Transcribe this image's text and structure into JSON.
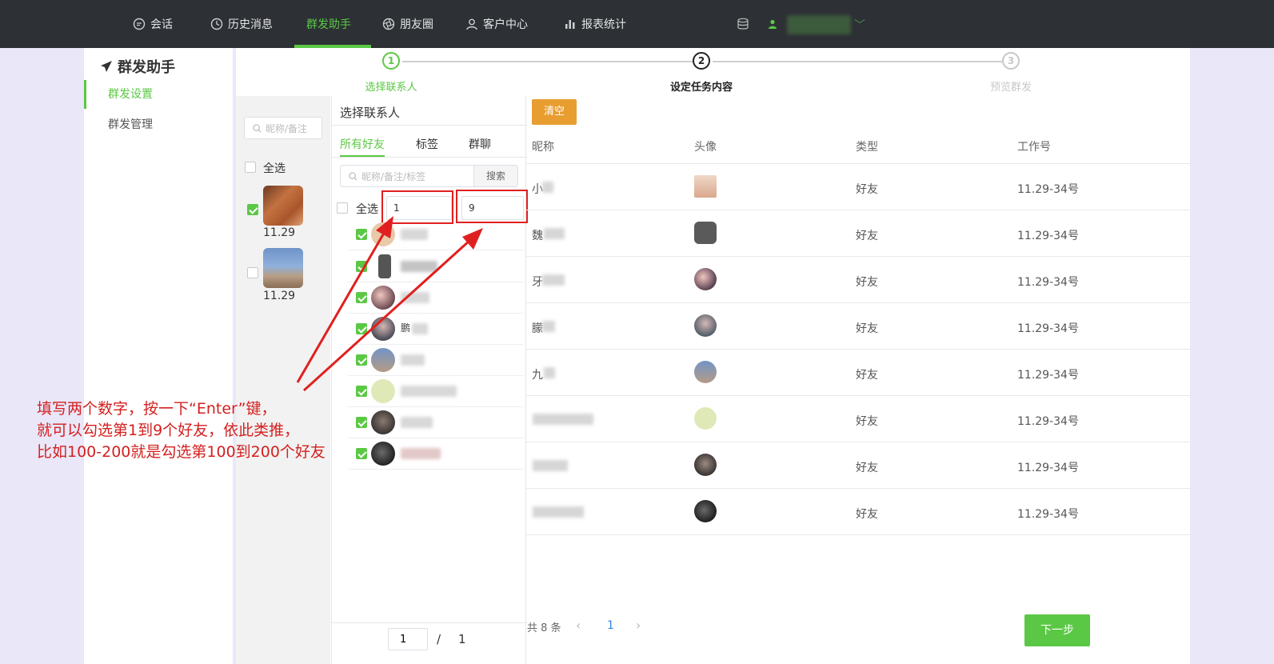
{
  "nav": {
    "items": [
      {
        "label": "会话",
        "icon": "chat-icon"
      },
      {
        "label": "历史消息",
        "icon": "clock-icon"
      },
      {
        "label": "群发助手",
        "icon": "",
        "active": true
      },
      {
        "label": "朋友圈",
        "icon": "aperture-icon"
      },
      {
        "label": "客户中心",
        "icon": "user-outline-icon"
      },
      {
        "label": "报表统计",
        "icon": "bar-chart-icon"
      }
    ],
    "accent_color": "#5bc845"
  },
  "sidebar": {
    "title": "群发助手",
    "items": [
      {
        "label": "群发设置",
        "active": true
      },
      {
        "label": "群发管理",
        "active": false
      }
    ]
  },
  "steps": [
    {
      "number": "1",
      "label": "选择联系人",
      "state": "done"
    },
    {
      "number": "2",
      "label": "设定任务内容",
      "state": "current"
    },
    {
      "number": "3",
      "label": "预览群发",
      "state": "pending"
    }
  ],
  "accounts": {
    "search_placeholder": "昵称/备注",
    "select_all": "全选",
    "list": [
      {
        "name": "11.29",
        "checked": true
      },
      {
        "name": "11.29",
        "checked": false
      }
    ]
  },
  "contacts": {
    "title": "选择联系人",
    "tabs": [
      "所有好友",
      "标签",
      "群聊"
    ],
    "search_placeholder": "昵称/备注/标签",
    "search_button": "搜索",
    "select_all": "全选",
    "range_from": "1",
    "range_to": "9",
    "rows": [
      {
        "checked": true
      },
      {
        "checked": true
      },
      {
        "checked": true,
        "name_char": "鹏"
      },
      {
        "checked": true
      },
      {
        "checked": true
      },
      {
        "checked": true
      },
      {
        "checked": true
      },
      {
        "checked": true
      }
    ],
    "pager": {
      "current": "1",
      "separator": "/",
      "total": "1"
    }
  },
  "selected": {
    "clear_button": "清空",
    "columns": [
      "昵称",
      "头像",
      "类型",
      "工作号"
    ],
    "rows": [
      {
        "nick": "小",
        "type": "好友",
        "account": "11.29-34号"
      },
      {
        "nick": "魏",
        "type": "好友",
        "account": "11.29-34号"
      },
      {
        "nick": "牙",
        "type": "好友",
        "account": "11.29-34号"
      },
      {
        "nick": "朦",
        "type": "好友",
        "account": "11.29-34号"
      },
      {
        "nick": "九",
        "type": "好友",
        "account": "11.29-34号"
      },
      {
        "nick": "",
        "type": "好友",
        "account": "11.29-34号"
      },
      {
        "nick": "",
        "type": "好友",
        "account": "11.29-34号"
      },
      {
        "nick": "",
        "type": "好友",
        "account": "11.29-34号"
      }
    ],
    "total": "共 8 条",
    "page": "1",
    "prev": "‹",
    "next_page": "›",
    "next_button": "下一步"
  },
  "annotation": {
    "lines": [
      "填写两个数字，按一下“Enter”键，",
      "就可以勾选第1到9个好友，依此类推，",
      "比如100-200就是勾选第100到200个好友"
    ],
    "color": "#d42020"
  }
}
